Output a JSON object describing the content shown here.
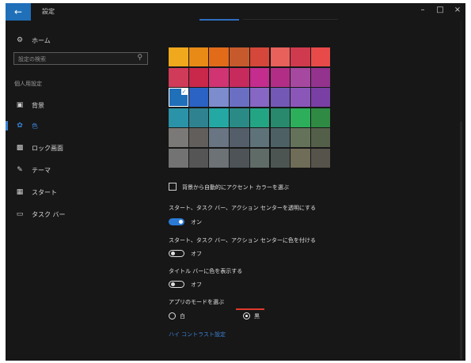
{
  "titlebar": {
    "back_icon": "back-arrow-icon",
    "title": "設定",
    "minimize": "–",
    "maximize": "□",
    "close": "×"
  },
  "sidebar": {
    "home": {
      "icon": "gear-icon",
      "label": "ホーム"
    },
    "search_placeholder": "設定の検索",
    "search_icon": "search-icon",
    "section": "個人用設定",
    "items": [
      {
        "icon": "picture-icon",
        "label": "背景",
        "active": false
      },
      {
        "icon": "palette-icon",
        "label": "色",
        "active": true
      },
      {
        "icon": "lock-screen-icon",
        "label": "ロック画面",
        "active": false
      },
      {
        "icon": "theme-brush-icon",
        "label": "テーマ",
        "active": false
      },
      {
        "icon": "start-grid-icon",
        "label": "スタート",
        "active": false
      },
      {
        "icon": "taskbar-icon",
        "label": "タスク バー",
        "active": false
      }
    ]
  },
  "palette": {
    "colors": [
      [
        "#f0a81c",
        "#e88a16",
        "#e26b1a",
        "#c75a2c",
        "#d4473a",
        "#e8615b",
        "#d03a4e",
        "#e84a4a"
      ],
      [
        "#d03b59",
        "#c9284a",
        "#d13473",
        "#c72a5d",
        "#c42c8e",
        "#b22e86",
        "#a6489f",
        "#93338e"
      ],
      [
        "#1f6fb9",
        "#2b63c4",
        "#7d8ccc",
        "#6b6fc4",
        "#8667c4",
        "#7358b6",
        "#8a57b8",
        "#7a3fa4"
      ],
      [
        "#2a93a8",
        "#2f8290",
        "#23a8a4",
        "#2a8a86",
        "#23a584",
        "#28896c",
        "#2dae5a",
        "#2f8a44"
      ],
      [
        "#7b7977",
        "#625e5b",
        "#6a7583",
        "#535e6a",
        "#5d7379",
        "#4d6064",
        "#65725a",
        "#535f48"
      ],
      [
        "#737373",
        "#555555",
        "#6c7276",
        "#4d5357",
        "#5f6b67",
        "#4c5552",
        "#6f6c57",
        "#55534a"
      ]
    ],
    "selected_row": 2,
    "selected_col": 0
  },
  "auto_accent": {
    "label": "背景から自動的にアクセント カラーを選ぶ",
    "checked": false
  },
  "transparency": {
    "label": "スタート、タスク バー、アクション センターを透明にする",
    "state_text": "オン",
    "on": true
  },
  "show_color_start": {
    "label": "スタート、タスク バー、アクション センターに色を付ける",
    "state_text": "オフ",
    "on": false
  },
  "title_bar_color": {
    "label": "タイトル バーに色を表示する",
    "state_text": "オフ",
    "on": false
  },
  "app_mode": {
    "label": "アプリのモードを選ぶ",
    "options": [
      {
        "label": "白",
        "selected": false
      },
      {
        "label": "黒",
        "selected": true
      }
    ]
  },
  "high_contrast_link": "ハイ コントラスト設定",
  "colors": {
    "accent": "#1f6fb9",
    "background": "#171717",
    "focus": "#e0392b"
  }
}
